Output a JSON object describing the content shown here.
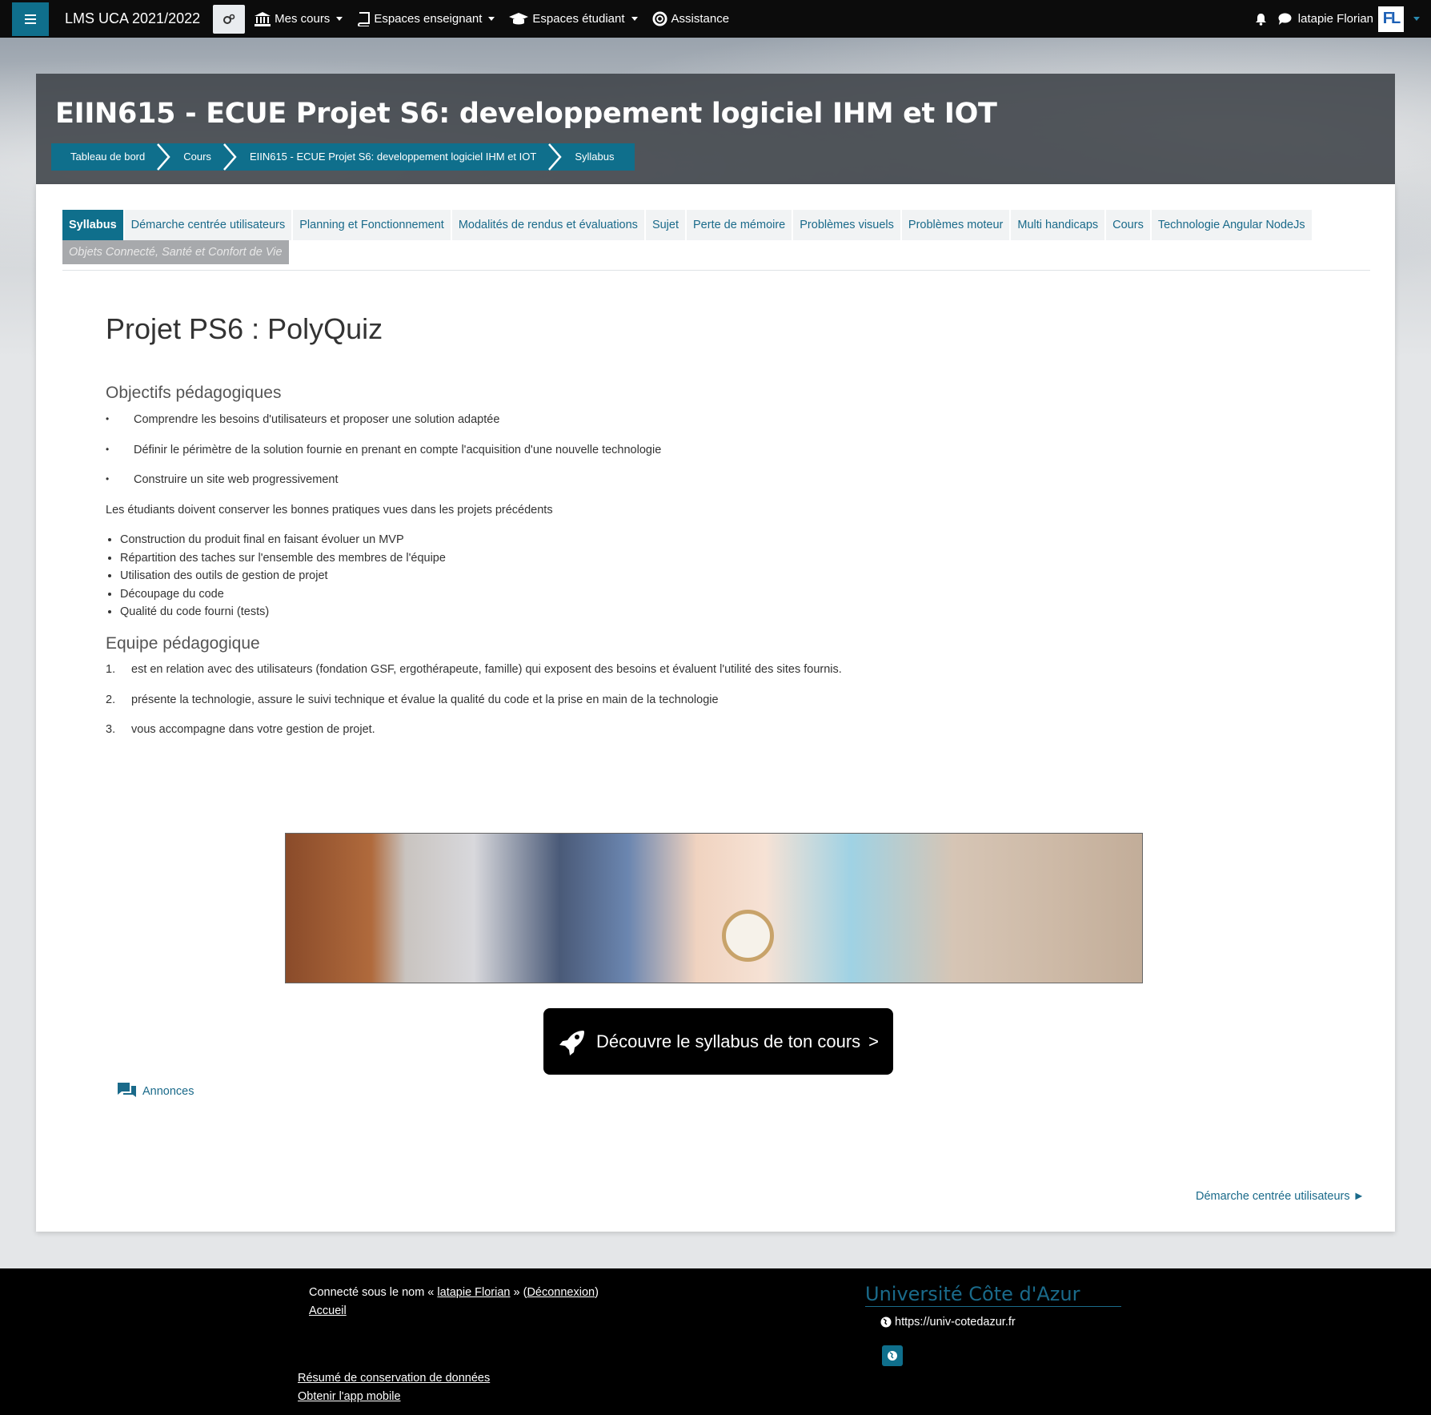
{
  "navbar": {
    "site_name": "LMS UCA 2021/2022",
    "menu": [
      {
        "label": "Mes cours",
        "icon": "bank-icon"
      },
      {
        "label": "Espaces enseignant",
        "icon": "book-icon"
      },
      {
        "label": "Espaces étudiant",
        "icon": "graduation-cap-icon"
      },
      {
        "label": "Assistance",
        "icon": "lifebuoy-icon"
      }
    ],
    "user_name": "latapie Florian",
    "avatar_initials": "FL"
  },
  "header": {
    "course_title": "EIIN615 - ECUE Projet S6: developpement logiciel IHM et IOT",
    "breadcrumb": [
      "Tableau de bord",
      "Cours",
      "EIIN615 - ECUE Projet S6: developpement logiciel IHM et IOT",
      "Syllabus"
    ]
  },
  "tabs": {
    "row1": [
      "Syllabus",
      "Démarche centrée utilisateurs",
      "Planning et Fonctionnement",
      "Modalités de rendus et évaluations",
      "Sujet",
      "Perte de mémoire",
      "Problèmes visuels",
      "Problèmes moteur",
      "Multi handicaps",
      "Cours",
      "Technologie Angular NodeJs"
    ],
    "row2": [
      "Objets Connecté, Santé et Confort de Vie"
    ],
    "active": "Syllabus"
  },
  "content": {
    "project_title": "Projet PS6 : PolyQuiz",
    "objectives_heading": "Objectifs pédagogiques",
    "objectives": [
      "Comprendre les besoins d'utilisateurs et proposer une solution adaptée",
      "Définir le périmètre de la solution fournie en prenant en compte l'acquisition d'une nouvelle technologie",
      "Construire un site web progressivement"
    ],
    "practices_intro": "Les étudiants doivent conserver les bonnes pratiques vues dans les projets précédents",
    "practices": [
      "Construction du produit final en faisant évoluer un MVP",
      "Répartition des taches sur l'ensemble des membres de l'équipe",
      "Utilisation des outils de gestion de projet",
      "Découpage du code",
      "Qualité du code fourni (tests)"
    ],
    "team_heading": "Equipe pédagogique",
    "team": [
      {
        "num": "1.",
        "text": "est en relation avec des utilisateurs (fondation GSF, ergothérapeute, famille)  qui exposent des besoins et évaluent l'utilité des sites fournis."
      },
      {
        "num": "2.",
        "text": "présente la technologie, assure le suivi technique et évalue la qualité du code et la prise en main de la technologie"
      },
      {
        "num": "3.",
        "text": "vous accompagne dans votre gestion de projet."
      }
    ],
    "cta_label": "Découvre le syllabus de ton cours",
    "cta_arrow": ">",
    "announcements_label": "Annonces",
    "next_link": "Démarche centrée utilisateurs ►"
  },
  "footer": {
    "login_prefix": "Connecté sous le nom « ",
    "login_user": "latapie Florian",
    "login_mid": " » (",
    "logout": "Déconnexion",
    "login_suffix": ")",
    "home": "Accueil",
    "data_retention": "Résumé de conservation de données",
    "mobile_app": "Obtenir l'app mobile",
    "university": "Université Côte d'Azur",
    "url": "https://univ-cotedazur.fr"
  },
  "colors": {
    "accent": "#0f6f8c",
    "link": "#1a6a8a",
    "navbar": "#0c0c0c"
  }
}
